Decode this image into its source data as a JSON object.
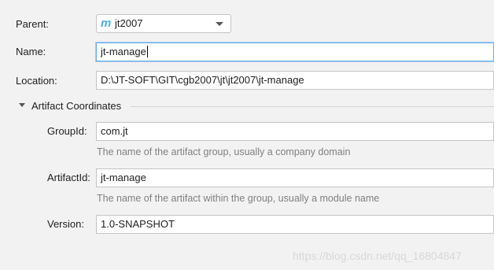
{
  "parent": {
    "label": "Parent:",
    "icon": "maven-m-icon",
    "value": "jt2007"
  },
  "name": {
    "label": "Name:",
    "value": "jt-manage"
  },
  "location": {
    "label": "Location:",
    "value": "D:\\JT-SOFT\\GIT\\cgb2007\\jt\\jt2007\\jt-manage"
  },
  "artifact": {
    "section_label": "Artifact Coordinates",
    "group_id": {
      "label": "GroupId:",
      "value": "com.jt",
      "hint": "The name of the artifact group, usually a company domain"
    },
    "artifact_id": {
      "label": "ArtifactId:",
      "value": "jt-manage",
      "hint": "The name of the artifact within the group, usually a module name"
    },
    "version": {
      "label": "Version:",
      "value": "1.0-SNAPSHOT"
    }
  },
  "watermark": "https://blog.csdn.net/qq_16804847"
}
